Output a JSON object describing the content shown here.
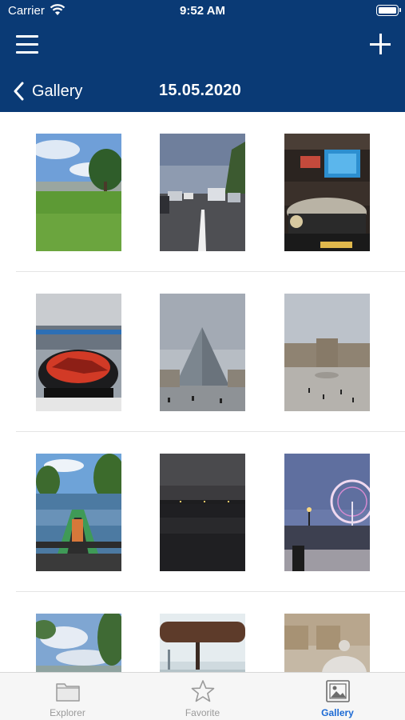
{
  "status_bar": {
    "carrier": "Carrier",
    "time": "9:52 AM",
    "wifi_icon": "wifi-icon",
    "battery_icon": "battery-icon"
  },
  "nav": {
    "back_label": "Gallery",
    "title": "15.05.2020",
    "menu_icon": "hamburger-menu-icon",
    "add_icon": "plus-icon",
    "back_icon": "chevron-left-icon"
  },
  "gallery": {
    "photos": [
      "park-lawn-photo",
      "highway-traffic-photo",
      "car-show-booth-photo",
      "red-sports-car-photo",
      "glass-pyramid-photo",
      "palace-courtyard-photo",
      "lake-boat-photo",
      "night-lake-photo",
      "ferris-wheel-photo",
      "cloudy-sky-trees-photo",
      "mirror-view-photo",
      "stone-urn-photo"
    ]
  },
  "tabbar": {
    "tabs": [
      {
        "label": "Explorer",
        "icon": "folder-icon",
        "active": false
      },
      {
        "label": "Favorite",
        "icon": "star-icon",
        "active": false
      },
      {
        "label": "Gallery",
        "icon": "gallery-icon",
        "active": true
      }
    ]
  },
  "colors": {
    "header": "#0a3a75",
    "active_tab": "#1c6ad4",
    "inactive_tab": "#9a9a9a"
  }
}
